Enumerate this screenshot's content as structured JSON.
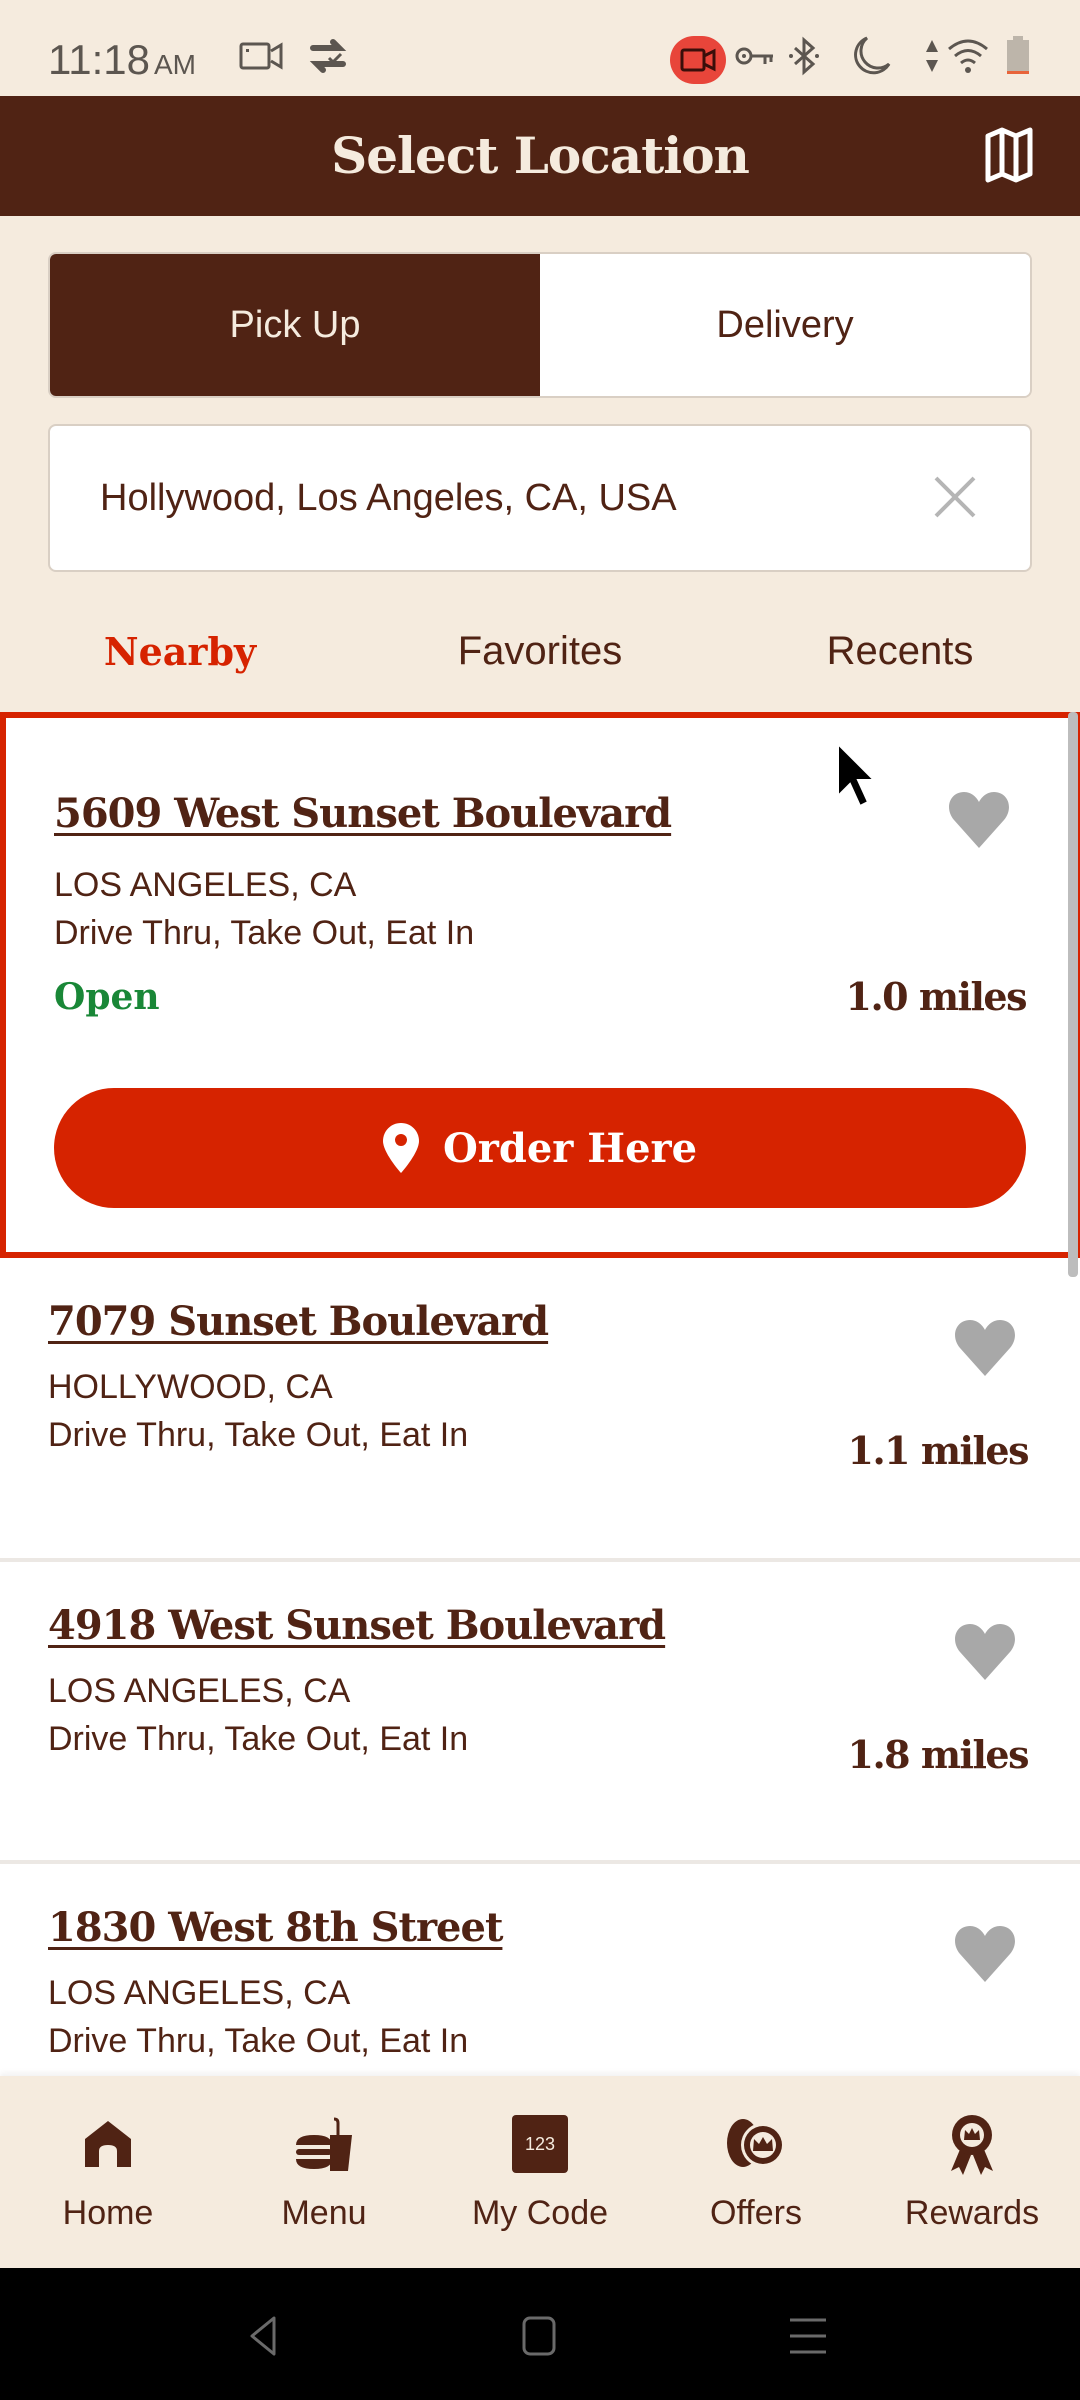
{
  "status_bar": {
    "time": "11:18",
    "ampm": "AM",
    "left_icons": [
      "screen-record-icon",
      "sync-icon"
    ],
    "right_icons": [
      "recording-indicator-icon",
      "vpn-key-icon",
      "bluetooth-icon",
      "do-not-disturb-moon-icon",
      "data-arrows-icon",
      "wifi-icon",
      "battery-low-icon"
    ]
  },
  "header": {
    "title": "Select Location",
    "map_button_icon": "map-icon"
  },
  "order_mode": {
    "options": [
      {
        "label": "Pick Up",
        "selected": true
      },
      {
        "label": "Delivery",
        "selected": false
      }
    ]
  },
  "search": {
    "value": "Hollywood, Los Angeles, CA, USA",
    "clear_icon": "close-icon"
  },
  "tabs": [
    {
      "label": "Nearby",
      "active": true
    },
    {
      "label": "Favorites",
      "active": false
    },
    {
      "label": "Recents",
      "active": false
    }
  ],
  "locations": [
    {
      "address": "5609 West Sunset Boulevard",
      "city": "LOS ANGELES, CA",
      "services": "Drive Thru, Take Out, Eat In",
      "status": "Open",
      "distance": "1.0 miles",
      "favorite": false,
      "selected": true,
      "order_button_label": "Order Here"
    },
    {
      "address": "7079 Sunset Boulevard",
      "city": "HOLLYWOOD, CA",
      "services": "Drive Thru, Take Out, Eat In",
      "distance": "1.1 miles",
      "favorite": false
    },
    {
      "address": "4918 West Sunset Boulevard",
      "city": "LOS ANGELES, CA",
      "services": "Drive Thru, Take Out, Eat In",
      "distance": "1.8 miles",
      "favorite": false
    },
    {
      "address": "1830 West 8th Street",
      "city": "LOS ANGELES, CA",
      "services": "Drive Thru, Take Out, Eat In",
      "favorite": false
    }
  ],
  "bottom_nav": [
    {
      "label": "Home",
      "icon": "home-icon"
    },
    {
      "label": "Menu",
      "icon": "burger-drink-icon"
    },
    {
      "label": "My Code",
      "icon": "code-123-icon",
      "icon_text": "123"
    },
    {
      "label": "Offers",
      "icon": "offers-coins-crown-icon"
    },
    {
      "label": "Rewards",
      "icon": "rewards-ribbon-icon"
    }
  ],
  "colors": {
    "brand_brown": "#502314",
    "accent_red": "#d62300",
    "open_green": "#198737",
    "background_cream": "#f5ebde",
    "heart_gray": "#a8a8a8"
  }
}
